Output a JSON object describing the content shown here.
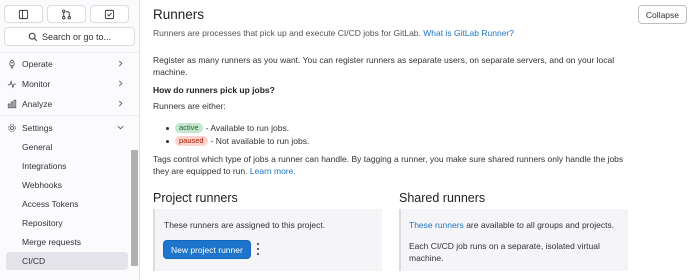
{
  "sidebar": {
    "search_label": "Search or go to...",
    "nav": [
      {
        "label": "Operate"
      },
      {
        "label": "Monitor"
      },
      {
        "label": "Analyze"
      },
      {
        "label": "Settings"
      }
    ],
    "settings_items": [
      {
        "label": "General"
      },
      {
        "label": "Integrations"
      },
      {
        "label": "Webhooks"
      },
      {
        "label": "Access Tokens"
      },
      {
        "label": "Repository"
      },
      {
        "label": "Merge requests"
      },
      {
        "label": "CI/CD"
      }
    ]
  },
  "main": {
    "title": "Runners",
    "collapse_label": "Collapse",
    "intro_text": "Runners are processes that pick up and execute CI/CD jobs for GitLab.",
    "intro_link": "What is GitLab Runner?",
    "register_line1": "Register as many runners as you want. You can register runners as separate users, on separate servers, and on your local",
    "register_line2": "machine.",
    "how_heading": "How do runners pick up jobs?",
    "either_text": "Runners are either:",
    "status_active_badge": "active",
    "status_active_text": "- Available to run jobs.",
    "status_paused_badge": "paused",
    "status_paused_text": "- Not available to run jobs.",
    "tags_line1": "Tags control which type of jobs a runner can handle. By tagging a runner, you make sure shared runners only handle the jobs",
    "tags_line2_text": "they are equipped to run.",
    "tags_link": "Learn more.",
    "project_runners": {
      "heading": "Project runners",
      "text": "These runners are assigned to this project.",
      "button": "New project runner"
    },
    "shared_runners": {
      "heading": "Shared runners",
      "link": "These runners",
      "text": "are available to all groups and projects.",
      "desc_line1": "Each CI/CD job runs on a separate, isolated virtual",
      "desc_line2": "machine."
    }
  },
  "colors": {
    "link": "#1f75cb",
    "primary_button": "#1f75cb",
    "active_badge_bg": "#c3e6cd",
    "paused_badge_bg": "#fdd4cd"
  },
  "icons": [
    "sidebar-toggle-icon",
    "merge-request-icon",
    "todo-icon",
    "search-icon",
    "rocket-icon",
    "monitor-icon",
    "chart-icon",
    "gear-icon",
    "chevron-icon",
    "kebab-icon"
  ]
}
